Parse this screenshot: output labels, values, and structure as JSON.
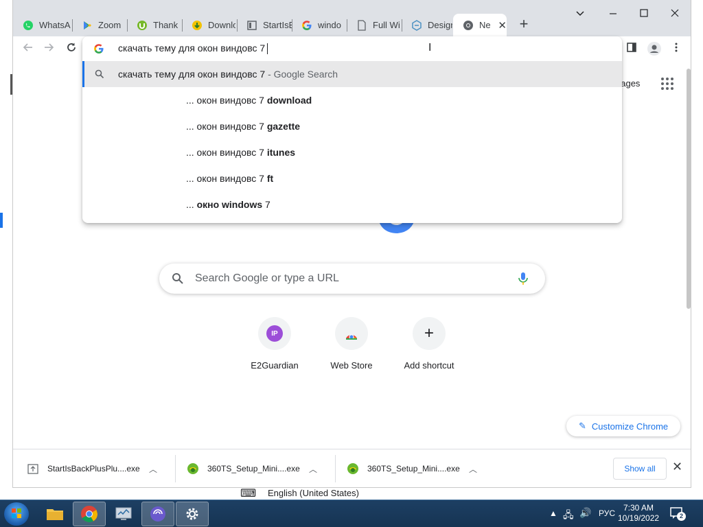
{
  "tabs": [
    {
      "label": "WhatsA",
      "icon": "whatsapp-icon"
    },
    {
      "label": "Zoom",
      "icon": "google-play-icon"
    },
    {
      "label": "Thank",
      "icon": "utorrent-icon"
    },
    {
      "label": "Downlo",
      "icon": "download-icon"
    },
    {
      "label": "StartIsB",
      "icon": "document-icon"
    },
    {
      "label": "windo",
      "icon": "google-icon"
    },
    {
      "label": "Full Wi",
      "icon": "page-icon"
    },
    {
      "label": "Design",
      "icon": "design-icon"
    },
    {
      "label": "Ne",
      "icon": "chrome-icon",
      "active": true
    }
  ],
  "omnibox": {
    "query": "скачать тему для окон виндовс 7",
    "suggestions": [
      {
        "prefix": "скачать тему для окон виндовс 7",
        "suffix": " - Google Search",
        "selected": true
      },
      {
        "prefix": "... окон виндовс 7 ",
        "bold": "download"
      },
      {
        "prefix": "... окон виндовс 7 ",
        "bold": "gazette"
      },
      {
        "prefix": "... окон виндовс 7 ",
        "bold": "itunes"
      },
      {
        "prefix": "... окон виндовс 7 ",
        "bold": "ft"
      },
      {
        "prefix": "... ",
        "bold": "окно windows",
        "after": " 7"
      }
    ]
  },
  "page": {
    "images_link": "nages",
    "search_placeholder": "Search Google or type a URL",
    "shortcuts": [
      {
        "label": "E2Guardian",
        "badge": "IP"
      },
      {
        "label": "Web Store"
      },
      {
        "label": "Add shortcut"
      }
    ],
    "customize_label": "Customize Chrome"
  },
  "downloads": {
    "items": [
      {
        "name": "StartIsBackPlusPlu....exe"
      },
      {
        "name": "360TS_Setup_Mini....exe"
      },
      {
        "name": "360TS_Setup_Mini....exe"
      }
    ],
    "show_all": "Show all"
  },
  "peek": {
    "text": "English (United States)"
  },
  "taskbar": {
    "language": "РУС",
    "time": "7:30 AM",
    "date": "10/19/2022",
    "notification_count": "2"
  },
  "colors": {
    "accent": "#1a73e8",
    "tabstrip": "#dee1e6",
    "taskbar": "#1d3f63"
  }
}
